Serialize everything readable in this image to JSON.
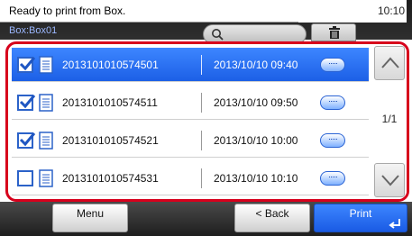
{
  "header": {
    "status_message": "Ready to print from Box.",
    "clock": "10:10",
    "box_path": "Box:Box01"
  },
  "icons": {
    "search": "search-icon",
    "trash": "trash-icon",
    "checkbox": "checkbox-icon",
    "document": "document-icon",
    "detail": "detail-icon",
    "scroll_up": "chevron-up-icon",
    "scroll_down": "chevron-down-icon",
    "enter": "enter-icon"
  },
  "files": [
    {
      "name": "2013101010574501",
      "date": "2013/10/10 09:40",
      "checked": true,
      "selected": true
    },
    {
      "name": "2013101010574511",
      "date": "2013/10/10 09:50",
      "checked": true,
      "selected": false
    },
    {
      "name": "2013101010574521",
      "date": "2013/10/10 10:00",
      "checked": true,
      "selected": false
    },
    {
      "name": "2013101010574531",
      "date": "2013/10/10 10:10",
      "checked": false,
      "selected": false
    }
  ],
  "pagination": {
    "label": "1/1"
  },
  "footer": {
    "menu_label": "Menu",
    "back_label": "< Back",
    "print_label": "Print"
  },
  "colors": {
    "accent_blue": "#1c5fe6",
    "highlight_red": "#d7001c",
    "status_bg": "#1e1e1e"
  }
}
